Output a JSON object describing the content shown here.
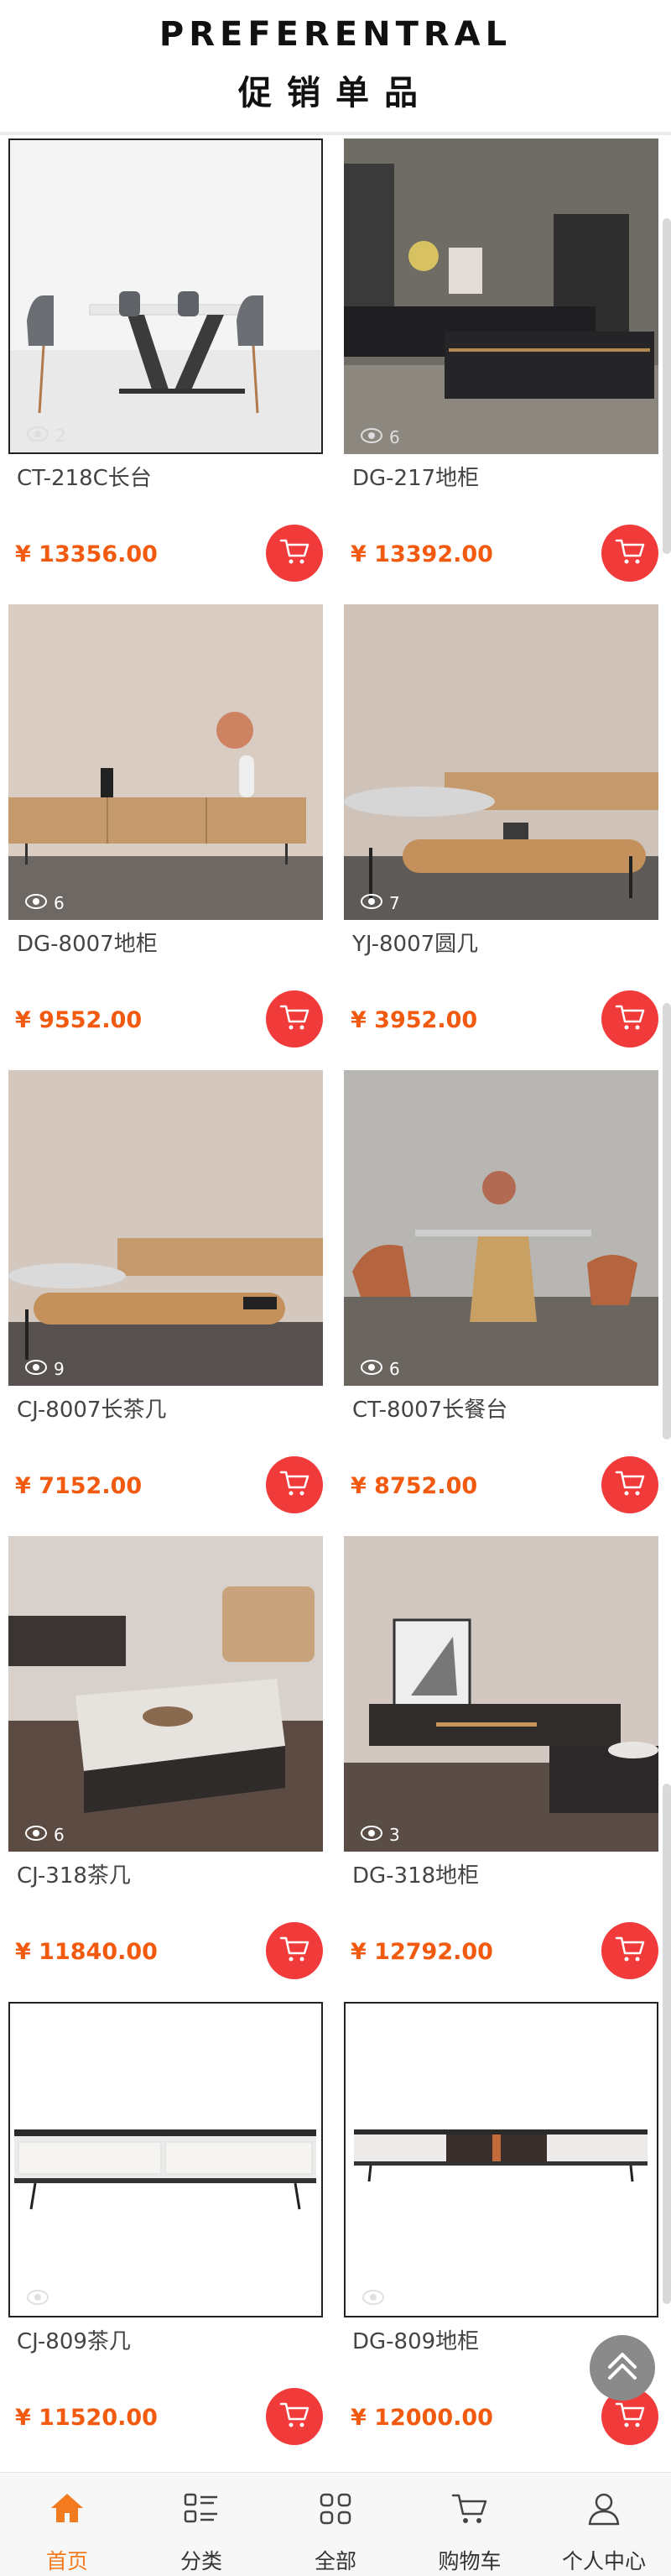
{
  "header": {
    "title_en": "PREFERENTRAL",
    "title_zh": "促销单品"
  },
  "products": [
    {
      "name": "CT-218C长台",
      "price": "¥ 13356.00",
      "views": "2",
      "scene": "dining-grey-chairs"
    },
    {
      "name": "DG-217地柜",
      "price": "¥ 13392.00",
      "views": "6",
      "scene": "black-tv-cabinet"
    },
    {
      "name": "DG-8007地柜",
      "price": "¥ 9552.00",
      "views": "6",
      "scene": "tan-cabinet"
    },
    {
      "name": "YJ-8007圆几",
      "price": "¥ 3952.00",
      "views": "7",
      "scene": "oval-coffee-table"
    },
    {
      "name": "CJ-8007长茶几",
      "price": "¥ 7152.00",
      "views": "9",
      "scene": "long-coffee-table"
    },
    {
      "name": "CT-8007长餐台",
      "price": "¥ 8752.00",
      "views": "6",
      "scene": "dining-orange-chairs"
    },
    {
      "name": "CJ-318茶几",
      "price": "¥ 11840.00",
      "views": "6",
      "scene": "square-coffee-table"
    },
    {
      "name": "DG-318地柜",
      "price": "¥ 12792.00",
      "views": "3",
      "scene": "dark-tv-cabinet"
    },
    {
      "name": "CJ-809茶几",
      "price": "¥ 11520.00",
      "views": "",
      "scene": "white-marble-table"
    },
    {
      "name": "DG-809地柜",
      "price": "¥ 12000.00",
      "views": "",
      "scene": "white-tv-cabinet"
    }
  ],
  "tabbar": [
    {
      "label": "首页",
      "icon": "home-icon",
      "active": true
    },
    {
      "label": "分类",
      "icon": "category-icon",
      "active": false
    },
    {
      "label": "全部",
      "icon": "grid-icon",
      "active": false
    },
    {
      "label": "购物车",
      "icon": "cart-icon",
      "active": false
    },
    {
      "label": "个人中心",
      "icon": "user-icon",
      "active": false
    }
  ],
  "colors": {
    "price": "#f25a0f",
    "cart_button": "#f13b3b",
    "active_tab": "#f47a1f"
  }
}
